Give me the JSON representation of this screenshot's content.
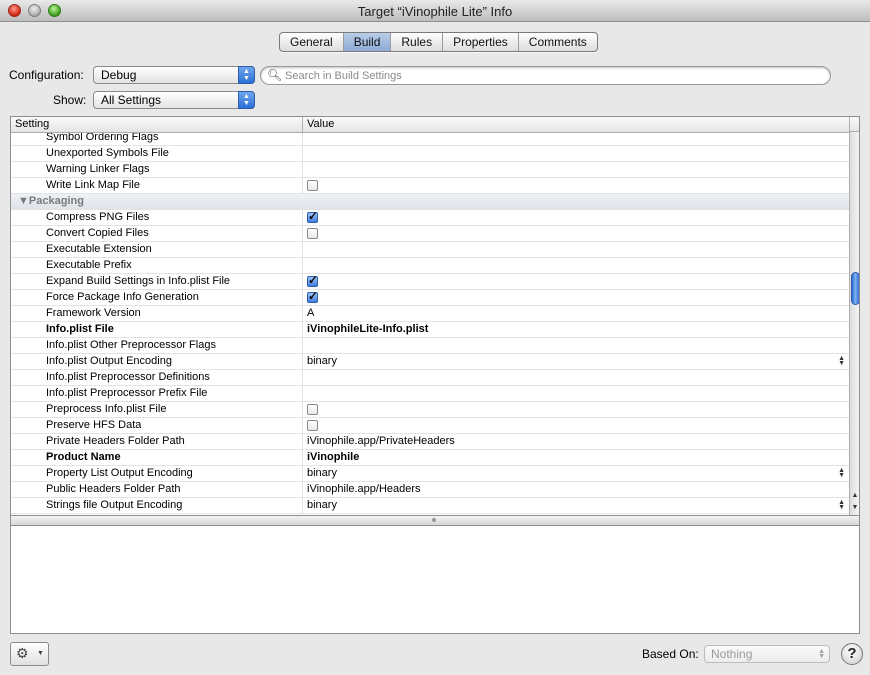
{
  "window": {
    "title": "Target “iVinophile Lite” Info"
  },
  "tabs": [
    {
      "label": "General",
      "active": false
    },
    {
      "label": "Build",
      "active": true
    },
    {
      "label": "Rules",
      "active": false
    },
    {
      "label": "Properties",
      "active": false
    },
    {
      "label": "Comments",
      "active": false
    }
  ],
  "configuration": {
    "label": "Configuration:",
    "value": "Debug"
  },
  "show": {
    "label": "Show:",
    "value": "All Settings"
  },
  "search": {
    "placeholder": "Search in Build Settings"
  },
  "table": {
    "headers": {
      "setting": "Setting",
      "value": "Value"
    },
    "rows": [
      {
        "name": "Symbol Ordering Flags",
        "value": ""
      },
      {
        "name": "Unexported Symbols File",
        "value": ""
      },
      {
        "name": "Warning Linker Flags",
        "value": ""
      },
      {
        "name": "Write Link Map File",
        "value": "",
        "checkbox": false
      },
      {
        "name": "▼Packaging",
        "group": true
      },
      {
        "name": "Compress PNG Files",
        "value": "",
        "checkbox": true
      },
      {
        "name": "Convert Copied Files",
        "value": "",
        "checkbox": false
      },
      {
        "name": "Executable Extension",
        "value": ""
      },
      {
        "name": "Executable Prefix",
        "value": ""
      },
      {
        "name": "Expand Build Settings in Info.plist File",
        "value": "",
        "checkbox": true
      },
      {
        "name": "Force Package Info Generation",
        "value": "",
        "checkbox": true
      },
      {
        "name": "Framework Version",
        "value": "A"
      },
      {
        "name": "Info.plist File",
        "value": "iVinophileLite-Info.plist",
        "bold": true
      },
      {
        "name": "Info.plist Other Preprocessor Flags",
        "value": ""
      },
      {
        "name": "Info.plist Output Encoding",
        "value": "binary",
        "stepper": true
      },
      {
        "name": "Info.plist Preprocessor Definitions",
        "value": ""
      },
      {
        "name": "Info.plist Preprocessor Prefix File",
        "value": ""
      },
      {
        "name": "Preprocess Info.plist File",
        "value": "",
        "checkbox": false
      },
      {
        "name": "Preserve HFS Data",
        "value": "",
        "checkbox": false
      },
      {
        "name": "Private Headers Folder Path",
        "value": "iVinophile.app/PrivateHeaders"
      },
      {
        "name": "Product Name",
        "value": "iVinophile",
        "bold": true
      },
      {
        "name": "Property List Output Encoding",
        "value": "binary",
        "stepper": true
      },
      {
        "name": "Public Headers Folder Path",
        "value": "iVinophile.app/Headers"
      },
      {
        "name": "Strings file Output Encoding",
        "value": "binary",
        "stepper": true
      }
    ]
  },
  "footer": {
    "based_on_label": "Based On:",
    "based_on_value": "Nothing",
    "help": "?"
  },
  "icons": {
    "gear": "gear-icon",
    "search": "search-icon",
    "help": "help-icon"
  }
}
